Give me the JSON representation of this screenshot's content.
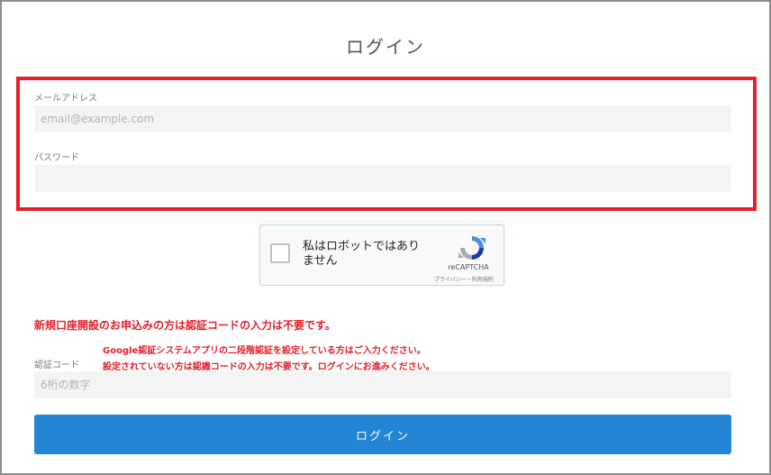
{
  "page": {
    "title": "ログイン"
  },
  "form": {
    "email_label": "メールアドレス",
    "email_placeholder": "email@example.com",
    "password_label": "パスワード",
    "password_placeholder": "",
    "code_label": "認証コード",
    "code_placeholder": "6桁の数字"
  },
  "recaptcha": {
    "checkbox_text": "私はロボットではありません",
    "brand": "reCAPTCHA",
    "links": "プライバシー・利用規約"
  },
  "notices": {
    "main": "新規口座開設のお申込みの方は認証コードの入力は不要です。",
    "line1": "Google認証システムアプリの二段階認証を設定している方はご入力ください。",
    "line2": "設定されていない方は認識コードの入力は不要です。ログインにお進みください。"
  },
  "buttons": {
    "login": "ログイン"
  },
  "colors": {
    "highlight": "#e3202b",
    "primary": "#2385d3",
    "notice": "#e3202b",
    "input_bg": "#f4f4f4"
  }
}
